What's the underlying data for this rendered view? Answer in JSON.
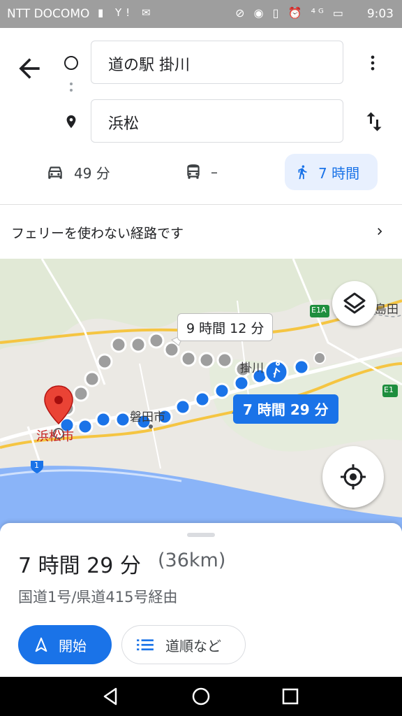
{
  "status": {
    "carrier": "NTT DOCOMO",
    "time": "9:03",
    "left_icons": "▮ Y! ✉",
    "right_icons": "⊘ ◉ ▯ ⏰ ⁴ᴳ ▭"
  },
  "route": {
    "from": "道の駅 掛川",
    "to": "浜松"
  },
  "modes": {
    "car": "49 分",
    "transit": "–",
    "walk": "7 時間"
  },
  "notice": "フェリーを使わない経路です",
  "map": {
    "alt_route_time": "9 時間 12 分",
    "main_route_time": "7 時間 29 分",
    "labels": {
      "iwata": "磐田市",
      "hamamatsu": "浜松市",
      "kakegawa": "掛川",
      "shimada": "島田",
      "e1a": "E1A",
      "e1": "E1",
      "route1": "1"
    }
  },
  "sheet": {
    "duration": "7 時間 29 分",
    "distance": "(36km)",
    "via": "国道1号/県道415号経由",
    "start_label": "開始",
    "steps_label": "道順など"
  },
  "colors": {
    "accent": "#1a73e8",
    "alt_route": "#9e9e9e",
    "pin": "#ea4335",
    "sea": "#8ab4f8"
  },
  "icons": [
    "back-arrow-icon",
    "origin-circle-icon",
    "destination-pin-icon",
    "more-vert-icon",
    "swap-icon",
    "car-icon",
    "bus-icon",
    "walk-icon",
    "chevron-right-icon",
    "layers-icon",
    "my-location-icon",
    "navigation-arrow-icon",
    "list-icon",
    "nav-back-icon",
    "nav-home-icon",
    "nav-recents-icon"
  ]
}
